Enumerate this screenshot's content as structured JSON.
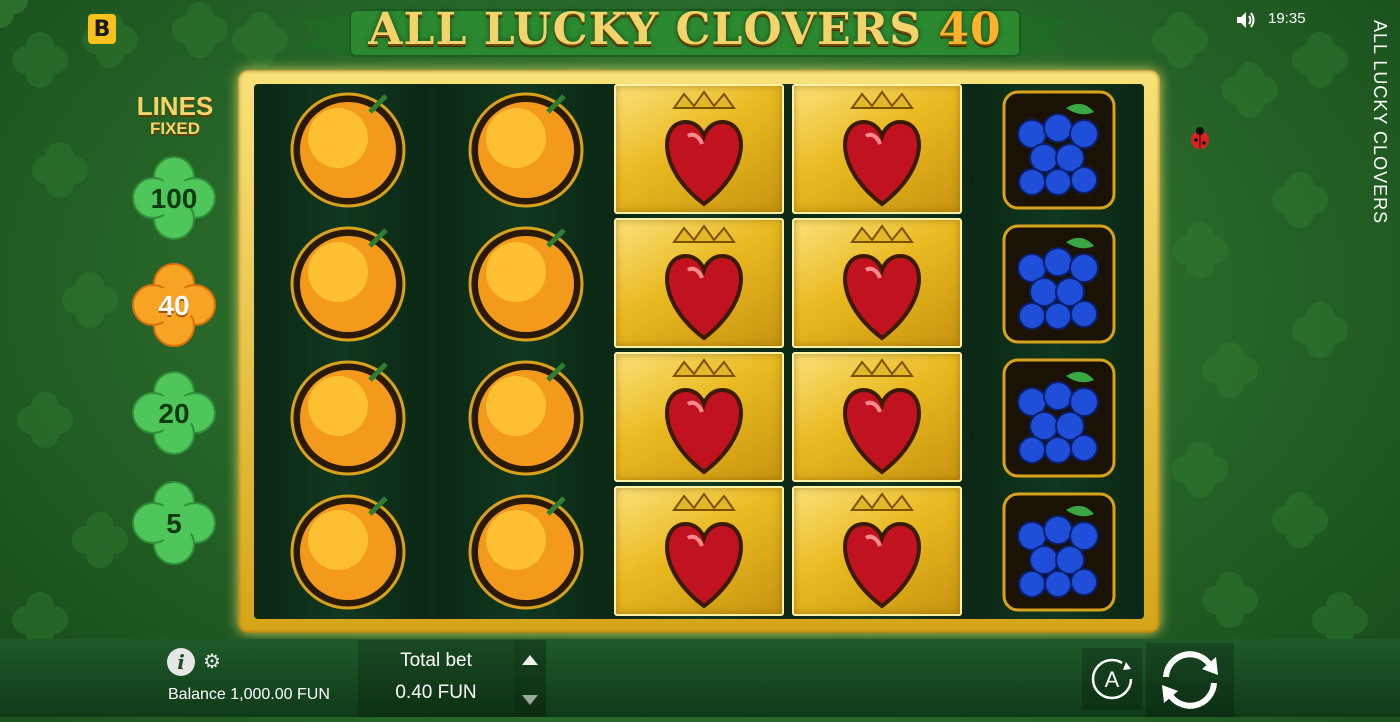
{
  "brand": {
    "badge": "B"
  },
  "header": {
    "title_main": "ALL LUCKY CLOVERS",
    "title_number": "40"
  },
  "status": {
    "time": "19:35",
    "sound_icon": "speaker-icon"
  },
  "side_title": "ALL LUCKY CLOVERS",
  "lines_panel": {
    "title": "LINES",
    "subtitle": "FIXED",
    "options": [
      {
        "label": "100",
        "active": false
      },
      {
        "label": "40",
        "active": true
      },
      {
        "label": "20",
        "active": false
      },
      {
        "label": "5",
        "active": false
      }
    ]
  },
  "reels": [
    [
      "orange",
      "orange",
      "orange",
      "orange"
    ],
    [
      "orange",
      "orange",
      "orange",
      "orange"
    ],
    [
      "crowned-heart",
      "crowned-heart",
      "crowned-heart",
      "crowned-heart"
    ],
    [
      "crowned-heart",
      "crowned-heart",
      "crowned-heart",
      "crowned-heart"
    ],
    [
      "grapes",
      "grapes",
      "grapes",
      "grapes"
    ]
  ],
  "bottom_bar": {
    "balance_label": "Balance 1,000.00 FUN",
    "total_bet_label": "Total bet",
    "total_bet_value": "0.40 FUN",
    "autoplay_label": "A"
  },
  "colors": {
    "frame_gold": "#e9b920",
    "clover_green": "#2e7a30",
    "active_orange": "#f39a1d"
  }
}
